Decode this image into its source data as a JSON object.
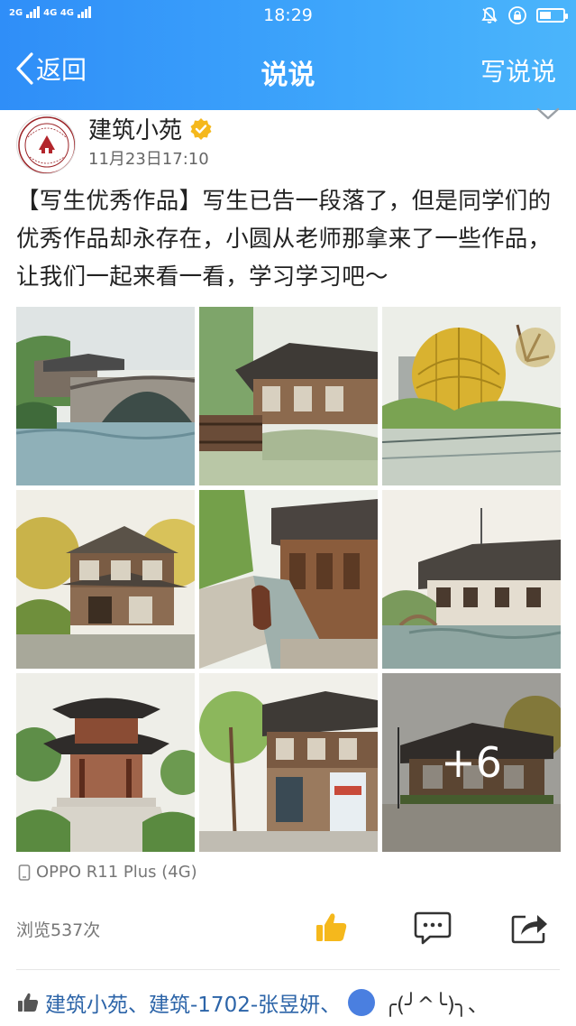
{
  "status_bar": {
    "network_left": "2G",
    "network_right": "4G 4G",
    "time": "18:29"
  },
  "nav": {
    "back_label": "返回",
    "title": "说说",
    "post_label": "写说说"
  },
  "post": {
    "author": "建筑小苑",
    "timestamp": "11月23日17:10",
    "text": "【写生优秀作品】写生已告一段落了，但是同学们的优秀作品却永存在，小圆从老师那拿来了一些作品，让我们一起来看一看，学习学习吧～",
    "more_photos": "+6",
    "device": "OPPO R11 Plus (4G)",
    "views": "浏览537次"
  },
  "likes": {
    "names": "建筑小苑、建筑-1702-张昱妍、",
    "emoji_name": "╭(╯^╰)╮、"
  },
  "colors": {
    "header_start": "#2f8ef8",
    "header_end": "#4bb5fb",
    "like_blue": "#2c64a8",
    "thumb_yellow": "#f5b81c"
  }
}
